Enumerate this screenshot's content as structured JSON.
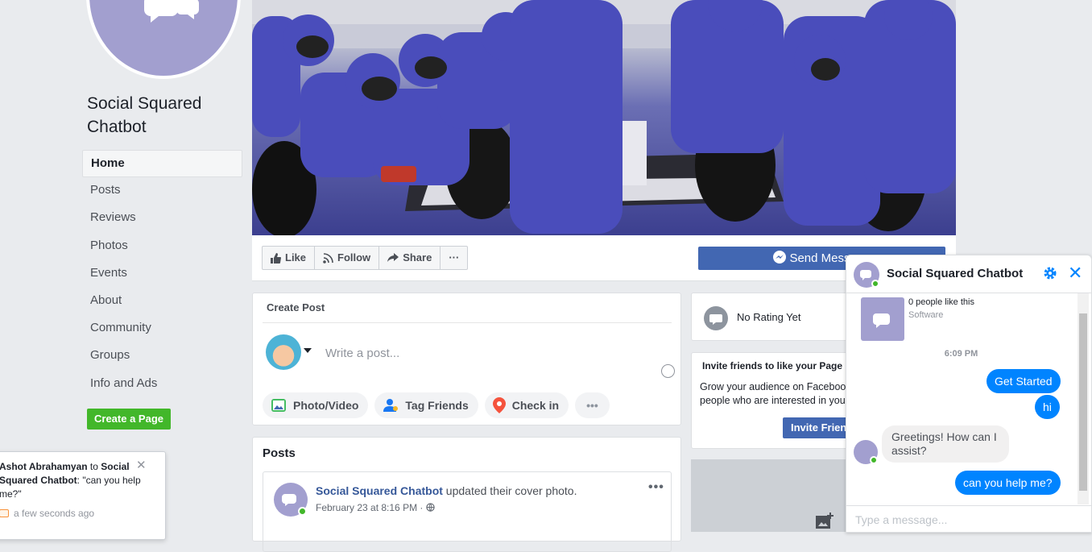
{
  "page": {
    "title": "Social Squared Chatbot"
  },
  "nav": {
    "items": [
      "Home",
      "Posts",
      "Reviews",
      "Photos",
      "Events",
      "About",
      "Community",
      "Groups",
      "Info and Ads"
    ]
  },
  "create_page_label": "Create a Page",
  "notification": {
    "actor": "Ashot Abrahamyan",
    "to": " to ",
    "target": "Social Squared Chatbot",
    "message": ": \"can you help me?\"",
    "time": "a few seconds ago"
  },
  "actions": {
    "like": "Like",
    "follow": "Follow",
    "share": "Share",
    "more": "···",
    "send_message": "Send Message"
  },
  "create_post": {
    "title": "Create Post",
    "placeholder": "Write a post...",
    "chips": [
      "Photo/Video",
      "Tag Friends",
      "Check in"
    ],
    "more": "•••"
  },
  "posts": {
    "title": "Posts",
    "author": "Social Squared Chatbot",
    "action": " updated their cover photo.",
    "date": "February 23 at 8:16 PM · ",
    "more": "•••"
  },
  "rating": {
    "text": "No Rating Yet"
  },
  "invite": {
    "title": "Invite friends to like your Page",
    "desc_line1": "Grow your audience on Facebook by inviting",
    "desc_line2": "people who are interested in your Page",
    "button": "Invite Friends"
  },
  "chat": {
    "title": "Social Squared Chatbot",
    "likes": "0 people like this",
    "category": "Software",
    "time": "6:09 PM",
    "messages": [
      {
        "from": "me",
        "text": "Get Started"
      },
      {
        "from": "me",
        "text": "hi"
      },
      {
        "from": "bot",
        "text": "Greetings! How can I assist?"
      },
      {
        "from": "me",
        "text": "can you help me?"
      }
    ],
    "input_placeholder": "Type a message...",
    "accent": "#0084ff"
  },
  "colors": {
    "brand_blue": "#4267b2",
    "green": "#42b72a",
    "avatar_purple": "#a29fcf",
    "background": "#e9ebee"
  }
}
